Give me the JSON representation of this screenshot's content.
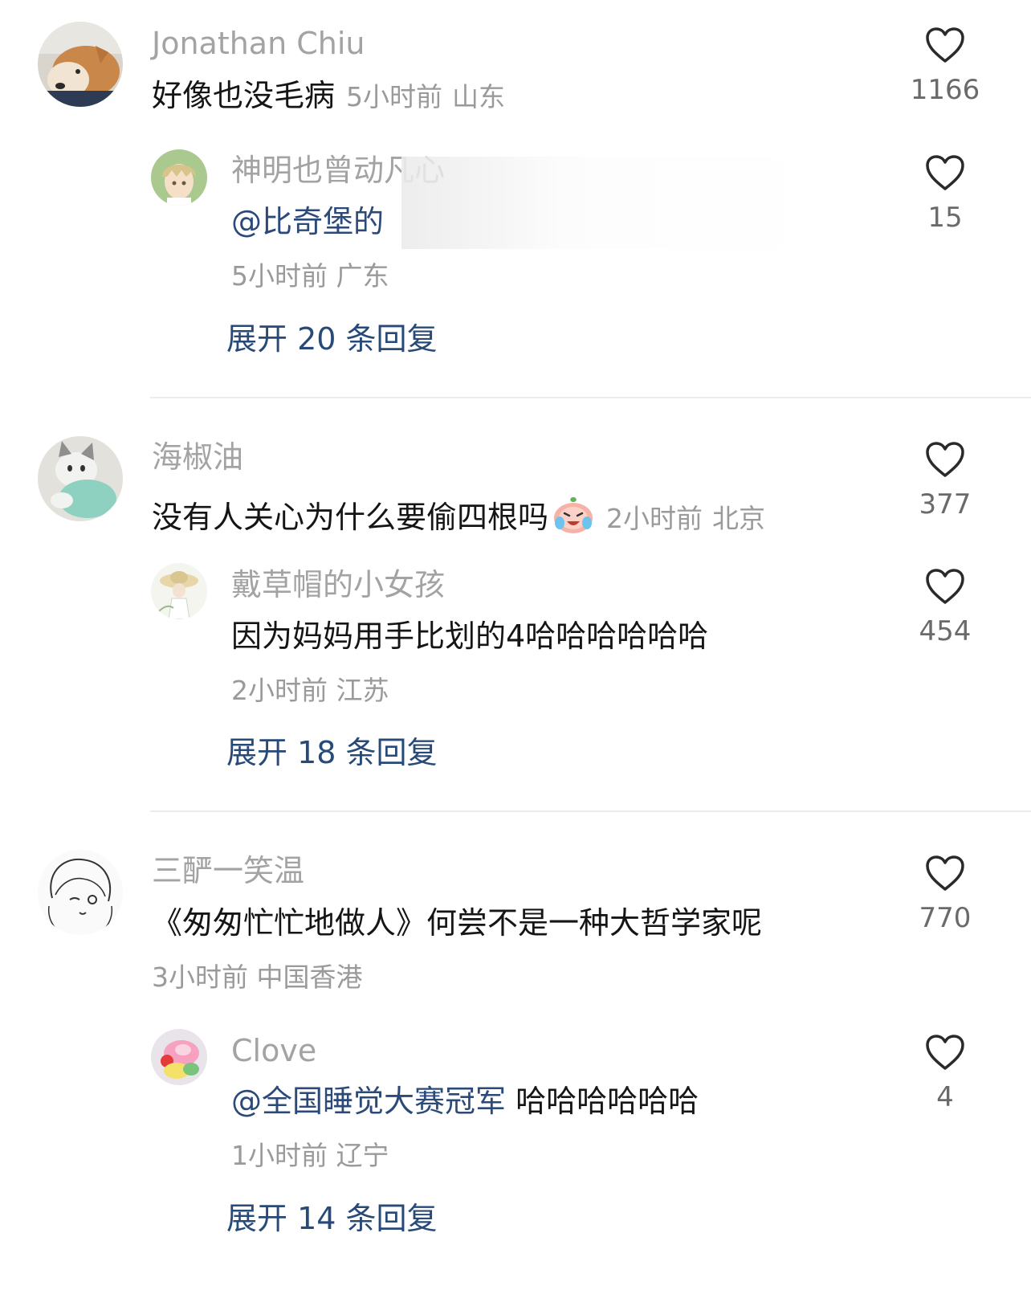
{
  "colors": {
    "name": "#a3a3a3",
    "text": "#151515",
    "meta": "#9a9a9a",
    "mention": "#2b4a7a",
    "expand": "#274a78",
    "like_icon": "#2a2a2a"
  },
  "comments": [
    {
      "name": "Jonathan Chiu",
      "text": "好像也没毛病",
      "time": "5小时前",
      "location": "山东",
      "likes": "1166",
      "avatar_icon": "shiba-dog-avatar",
      "reply": {
        "name": "神明也曾动凡心",
        "mention": "@比奇堡的",
        "text": "",
        "time": "5小时前",
        "location": "广东",
        "likes": "15",
        "avatar_icon": "anime-boy-avatar"
      },
      "expand_label": "展开 20 条回复"
    },
    {
      "name": "海椒油",
      "text": "没有人关心为什么要偷四根吗",
      "emoji": "crying-laughing-peach-emoji",
      "time": "2小时前",
      "location": "北京",
      "likes": "377",
      "avatar_icon": "cat-avatar",
      "reply": {
        "name": "戴草帽的小女孩",
        "mention": "",
        "text": "因为妈妈用手比划的4哈哈哈哈哈哈",
        "time": "2小时前",
        "location": "江苏",
        "likes": "454",
        "avatar_icon": "straw-hat-girl-avatar"
      },
      "expand_label": "展开 18 条回复"
    },
    {
      "name": "三酽一笑温",
      "text": "《匆匆忙忙地做人》何尝不是一种大哲学家呢",
      "time": "3小时前",
      "location": "中国香港",
      "likes": "770",
      "avatar_icon": "sketch-girl-avatar",
      "reply": {
        "name": "Clove",
        "mention": "@全国睡觉大赛冠军",
        "text": "哈哈哈哈哈哈",
        "time": "1小时前",
        "location": "辽宁",
        "likes": "4",
        "avatar_icon": "strawberry-cake-avatar"
      },
      "expand_label": "展开 14 条回复"
    }
  ]
}
